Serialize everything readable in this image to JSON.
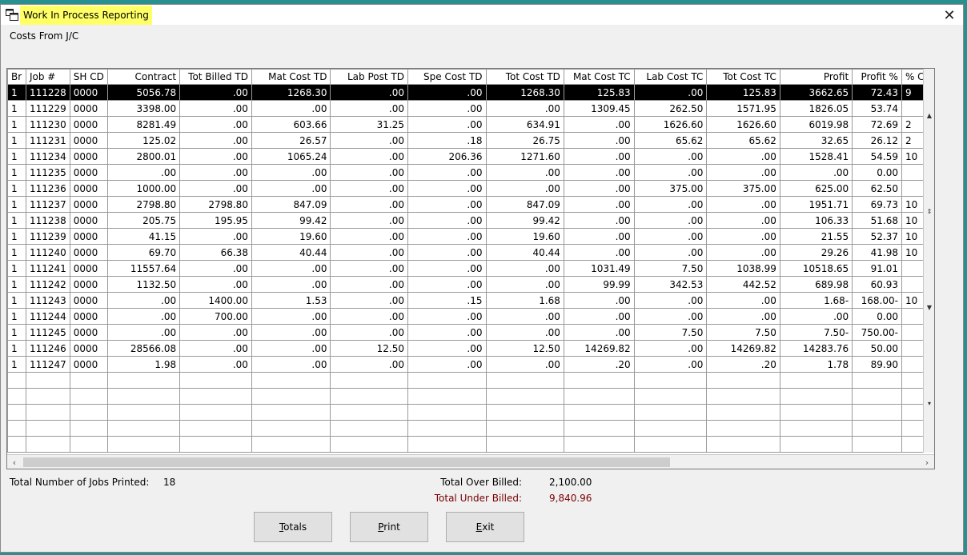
{
  "window": {
    "title": "Work In Process Reporting",
    "close_symbol": "✕"
  },
  "subtitle": "Costs From J/C",
  "grid": {
    "columns": [
      "Br",
      "Job #",
      "SH CD",
      "Contract",
      "Tot Billed TD",
      "Mat Cost TD",
      "Lab Post TD",
      "Spe Cost TD",
      "Tot Cost TD",
      "Mat Cost TC",
      "Lab Cost TC",
      "Tot Cost TC",
      "Profit",
      "Profit %",
      "% Co"
    ],
    "rows": [
      [
        "1",
        "111228",
        "0000",
        "5056.78",
        ".00",
        "1268.30",
        ".00",
        ".00",
        "1268.30",
        "125.83",
        ".00",
        "125.83",
        "3662.65",
        "72.43",
        "9"
      ],
      [
        "1",
        "111229",
        "0000",
        "3398.00",
        ".00",
        ".00",
        ".00",
        ".00",
        ".00",
        "1309.45",
        "262.50",
        "1571.95",
        "1826.05",
        "53.74",
        ""
      ],
      [
        "1",
        "111230",
        "0000",
        "8281.49",
        ".00",
        "603.66",
        "31.25",
        ".00",
        "634.91",
        ".00",
        "1626.60",
        "1626.60",
        "6019.98",
        "72.69",
        "2"
      ],
      [
        "1",
        "111231",
        "0000",
        "125.02",
        ".00",
        "26.57",
        ".00",
        ".18",
        "26.75",
        ".00",
        "65.62",
        "65.62",
        "32.65",
        "26.12",
        "2"
      ],
      [
        "1",
        "111234",
        "0000",
        "2800.01",
        ".00",
        "1065.24",
        ".00",
        "206.36",
        "1271.60",
        ".00",
        ".00",
        ".00",
        "1528.41",
        "54.59",
        "10"
      ],
      [
        "1",
        "111235",
        "0000",
        ".00",
        ".00",
        ".00",
        ".00",
        ".00",
        ".00",
        ".00",
        ".00",
        ".00",
        ".00",
        "0.00",
        ""
      ],
      [
        "1",
        "111236",
        "0000",
        "1000.00",
        ".00",
        ".00",
        ".00",
        ".00",
        ".00",
        ".00",
        "375.00",
        "375.00",
        "625.00",
        "62.50",
        ""
      ],
      [
        "1",
        "111237",
        "0000",
        "2798.80",
        "2798.80",
        "847.09",
        ".00",
        ".00",
        "847.09",
        ".00",
        ".00",
        ".00",
        "1951.71",
        "69.73",
        "10"
      ],
      [
        "1",
        "111238",
        "0000",
        "205.75",
        "195.95",
        "99.42",
        ".00",
        ".00",
        "99.42",
        ".00",
        ".00",
        ".00",
        "106.33",
        "51.68",
        "10"
      ],
      [
        "1",
        "111239",
        "0000",
        "41.15",
        ".00",
        "19.60",
        ".00",
        ".00",
        "19.60",
        ".00",
        ".00",
        ".00",
        "21.55",
        "52.37",
        "10"
      ],
      [
        "1",
        "111240",
        "0000",
        "69.70",
        "66.38",
        "40.44",
        ".00",
        ".00",
        "40.44",
        ".00",
        ".00",
        ".00",
        "29.26",
        "41.98",
        "10"
      ],
      [
        "1",
        "111241",
        "0000",
        "11557.64",
        ".00",
        ".00",
        ".00",
        ".00",
        ".00",
        "1031.49",
        "7.50",
        "1038.99",
        "10518.65",
        "91.01",
        ""
      ],
      [
        "1",
        "111242",
        "0000",
        "1132.50",
        ".00",
        ".00",
        ".00",
        ".00",
        ".00",
        "99.99",
        "342.53",
        "442.52",
        "689.98",
        "60.93",
        ""
      ],
      [
        "1",
        "111243",
        "0000",
        ".00",
        "1400.00",
        "1.53",
        ".00",
        ".15",
        "1.68",
        ".00",
        ".00",
        ".00",
        "1.68-",
        "168.00-",
        "10"
      ],
      [
        "1",
        "111244",
        "0000",
        ".00",
        "700.00",
        ".00",
        ".00",
        ".00",
        ".00",
        ".00",
        ".00",
        ".00",
        ".00",
        "0.00",
        ""
      ],
      [
        "1",
        "111245",
        "0000",
        ".00",
        ".00",
        ".00",
        ".00",
        ".00",
        ".00",
        ".00",
        "7.50",
        "7.50",
        "7.50-",
        "750.00-",
        ""
      ],
      [
        "1",
        "111246",
        "0000",
        "28566.08",
        ".00",
        ".00",
        "12.50",
        ".00",
        "12.50",
        "14269.82",
        ".00",
        "14269.82",
        "14283.76",
        "50.00",
        ""
      ],
      [
        "1",
        "111247",
        "0000",
        "1.98",
        ".00",
        ".00",
        ".00",
        ".00",
        ".00",
        ".20",
        ".00",
        ".20",
        "1.78",
        "89.90",
        ""
      ]
    ],
    "empty_rows": 5,
    "selected_row": 0
  },
  "summary": {
    "jobs_label": "Total Number of Jobs Printed:",
    "jobs_value": "18",
    "over_label": "Total Over Billed:",
    "over_value": "2,100.00",
    "under_label": "Total Under Billed:",
    "under_value": "9,840.96",
    "under_color": "#7a0000"
  },
  "buttons": {
    "totals": {
      "hotkey": "T",
      "rest": "otals"
    },
    "print": {
      "hotkey": "P",
      "rest": "rint"
    },
    "exit": {
      "hotkey": "E",
      "rest": "xit"
    }
  }
}
